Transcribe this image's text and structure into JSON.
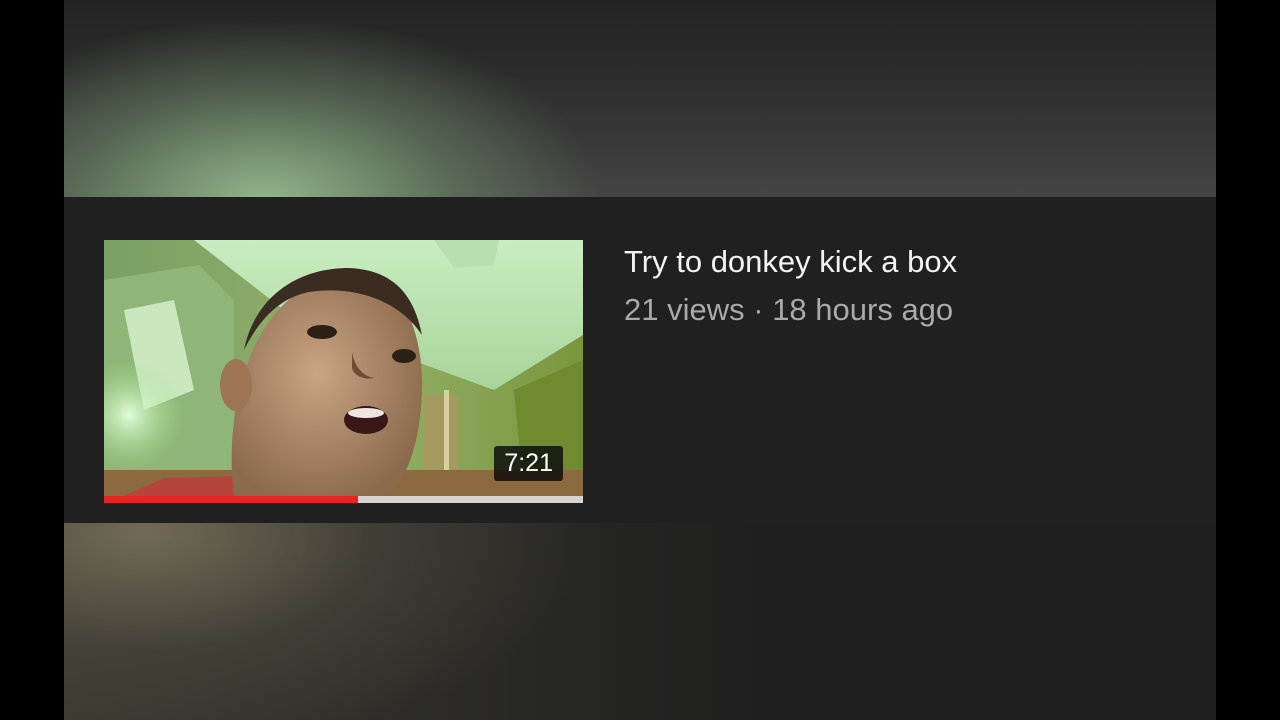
{
  "video": {
    "title": "Try to donkey kick a box",
    "views": "21 views",
    "separator": "·",
    "age": "18 hours ago",
    "duration": "7:21",
    "watch_progress": 0.53
  },
  "colors": {
    "progress_fill": "#e52620",
    "progress_track": "#d9d4cf",
    "card_background": "#202020",
    "title_text": "#f3f3f3",
    "meta_text": "#a9a9a9"
  }
}
